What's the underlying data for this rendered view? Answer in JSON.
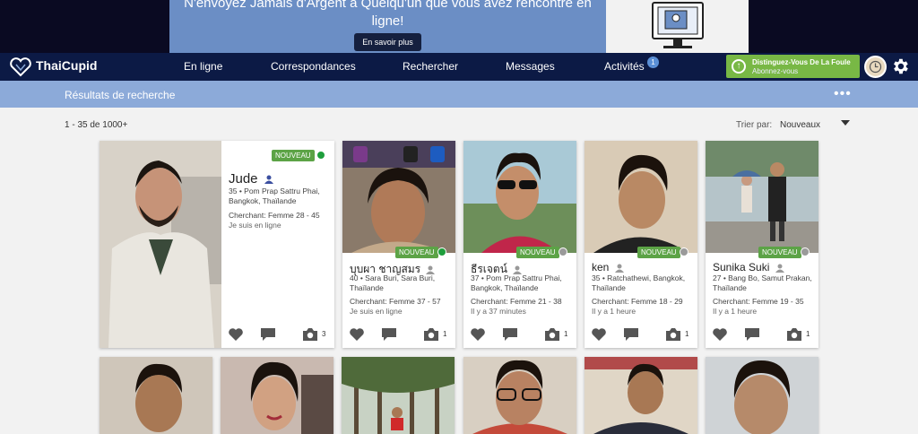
{
  "banner": {
    "text": "N'envoyez Jamais d'Argent à Quelqu'un que vous avez rencontré en ligne!",
    "button": "En savoir plus"
  },
  "nav": {
    "brand": "ThaiCupid",
    "items": [
      "En ligne",
      "Correspondances",
      "Rechercher",
      "Messages",
      "Activités"
    ],
    "activity_badge": "1",
    "promo_line1": "Distinguez-Vous De La Foule",
    "promo_line2": "Abonnez-vous"
  },
  "results": {
    "title": "Résultats de recherche",
    "count": "1 - 35 de 1000+",
    "sort_label": "Trier par:",
    "sort_value": "Nouveaux"
  },
  "profiles": [
    {
      "name": "Jude",
      "badge": "NOUVEAU",
      "location": "35 • Pom Prap Sattru Phai, Bangkok, Thaïlande",
      "seeking": "Cherchant: Femme 28 - 45",
      "last_seen": "Je suis en ligne",
      "online": true,
      "photos": "3"
    },
    {
      "name": "บุบผา ชาญสมร",
      "badge": "NOUVEAU",
      "location": "40 • Sara Buri, Sara Buri, Thaïlande",
      "seeking": "Cherchant: Femme 37 - 57",
      "last_seen": "Je suis en ligne",
      "online": true,
      "photos": "1"
    },
    {
      "name": "ธีรเจตน์",
      "badge": "NOUVEAU",
      "location": "37 • Pom Prap Sattru Phai, Bangkok, Thaïlande",
      "seeking": "Cherchant: Femme 21 - 38",
      "last_seen": "Il y a 37 minutes",
      "online": false,
      "photos": "1"
    },
    {
      "name": "ken",
      "badge": "NOUVEAU",
      "location": "35 • Ratchathewi, Bangkok, Thaïlande",
      "seeking": "Cherchant: Femme 18 - 29",
      "last_seen": "Il y a 1 heure",
      "online": false,
      "photos": "1"
    },
    {
      "name": "Sunika Suki",
      "badge": "NOUVEAU",
      "location": "27 • Bang Bo, Samut Prakan, Thaïlande",
      "seeking": "Cherchant: Femme 19 - 35",
      "last_seen": "Il y a 1 heure",
      "online": false,
      "photos": "1"
    }
  ],
  "colors": {
    "nav": "#0c1a45",
    "subheader": "#8caad9",
    "new_badge": "#5ca346",
    "online": "#1f9e3c",
    "offline": "#9a9a9a",
    "promo": "#78b845"
  }
}
